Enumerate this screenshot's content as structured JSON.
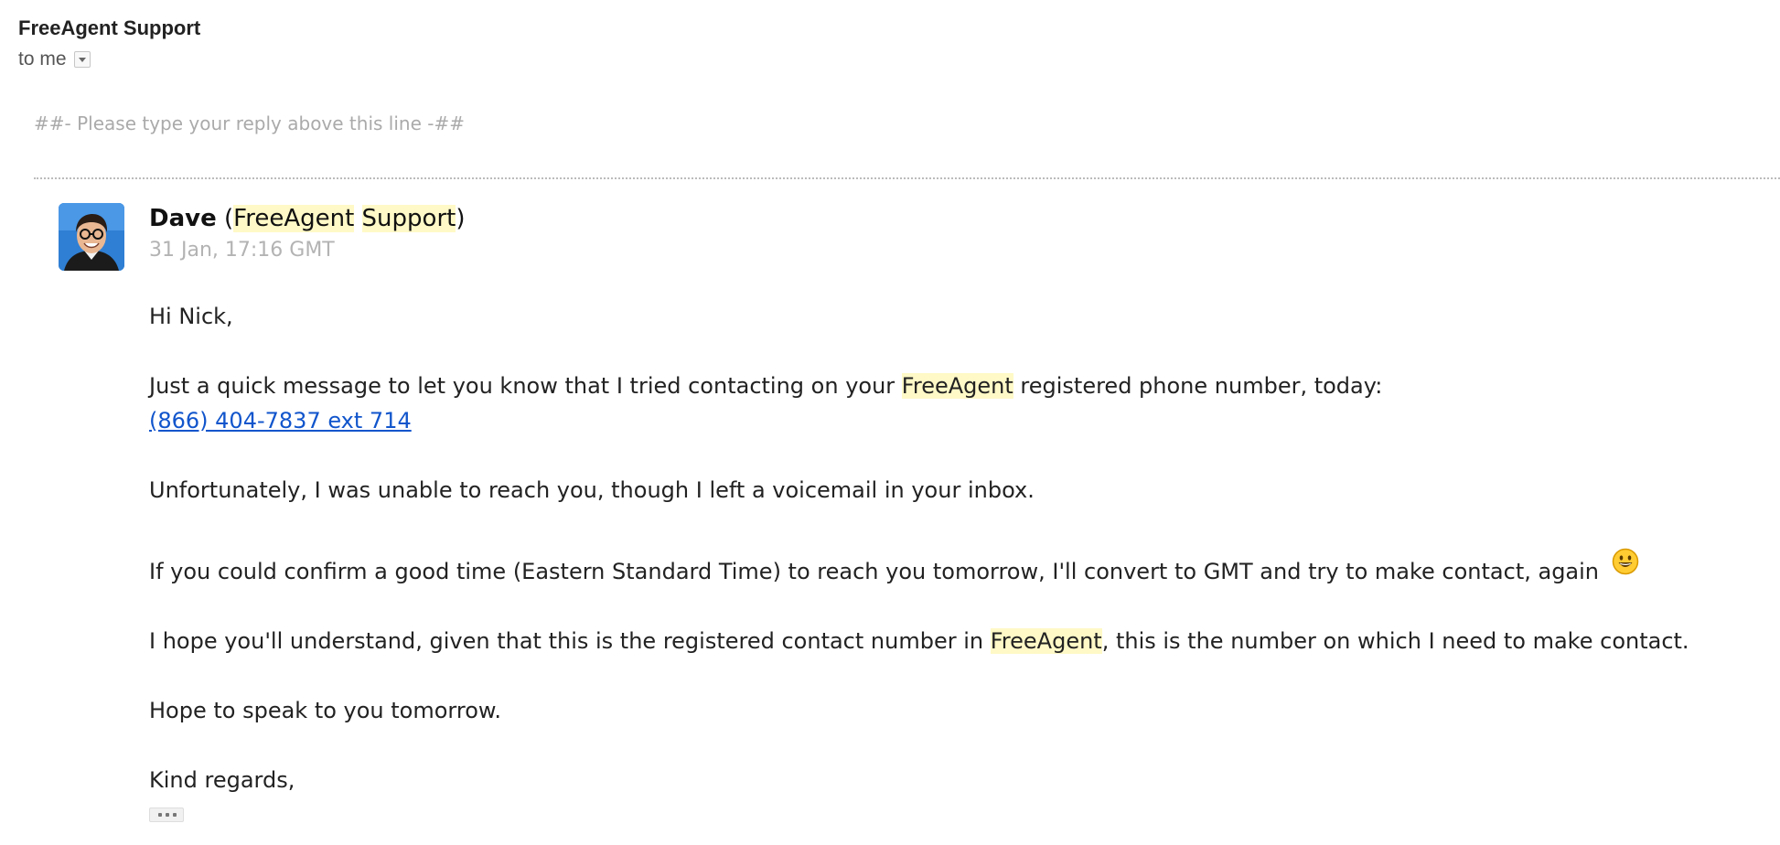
{
  "header": {
    "sender": "FreeAgent Support",
    "recipient": "to me"
  },
  "reply_marker": "##- Please type your reply above this line -##",
  "message": {
    "author": "Dave",
    "org_open": "(",
    "org_word1": "FreeAgent",
    "org_word2": "Support",
    "org_close": ")",
    "timestamp": "31 Jan, 17:16 GMT",
    "greeting": "Hi Nick,",
    "p1_before": "Just a quick message to let you know that I tried contacting on your ",
    "p1_highlight": "FreeAgent",
    "p1_after": " registered phone number, today:",
    "phone_link": "(866) 404-7837 ext 714",
    "p2": "Unfortunately, I was unable to reach you, though I left a voicemail in your inbox.",
    "p3": "If you could confirm a good time (Eastern Standard Time) to reach you tomorrow, I'll convert to GMT and try to make contact, again",
    "p4_before": "I hope you'll understand, given that this is the registered contact number in ",
    "p4_highlight": "FreeAgent",
    "p4_after": ", this is the number on which I need to make contact.",
    "p5": "Hope to speak to you tomorrow.",
    "signoff": "Kind regards,"
  },
  "colors": {
    "highlight": "#fff9c7",
    "link": "#1155cc",
    "muted": "#b3b3b3"
  },
  "icons": {
    "details_toggle": "chevron-down-icon",
    "avatar": "avatar",
    "emoji": "smiley-icon",
    "trimmed": "ellipsis-icon"
  }
}
